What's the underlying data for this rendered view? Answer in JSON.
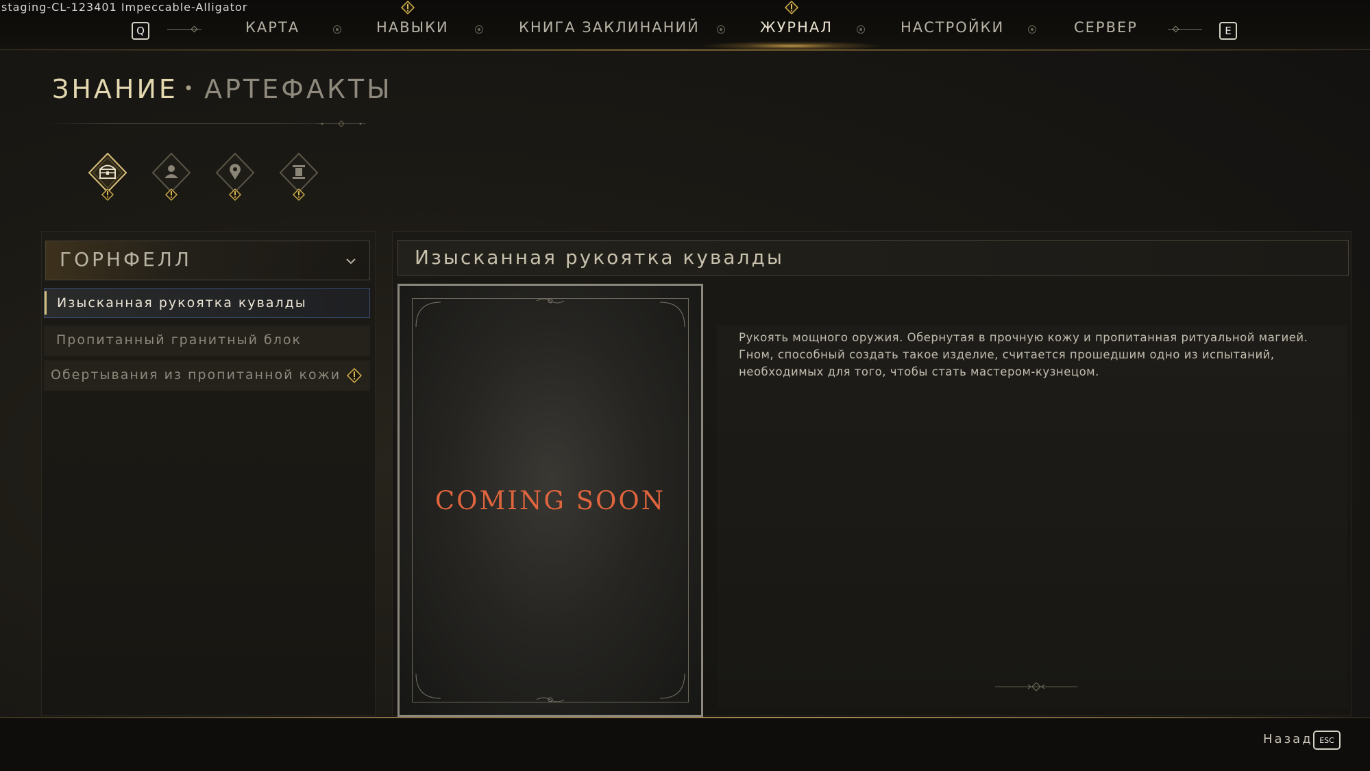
{
  "build_label": "staging-CL-123401 Impeccable-Alligator",
  "nav": {
    "left_key": "Q",
    "right_key": "E",
    "tabs": [
      {
        "label": "КАРТА",
        "active": false,
        "alert": false
      },
      {
        "label": "НАВЫКИ",
        "active": false,
        "alert": true
      },
      {
        "label": "КНИГА ЗАКЛИНАНИЙ",
        "active": false,
        "alert": false
      },
      {
        "label": "ЖУРНАЛ",
        "active": true,
        "alert": true
      },
      {
        "label": "НАСТРОЙКИ",
        "active": false,
        "alert": false
      },
      {
        "label": "СЕРВЕР",
        "active": false,
        "alert": false
      }
    ]
  },
  "header": {
    "section": "ЗНАНИЕ",
    "separator": "•",
    "subsection": "АРТЕФАКТЫ"
  },
  "categories": [
    {
      "icon": "chest-icon",
      "active": true,
      "alert": true
    },
    {
      "icon": "person-icon",
      "active": false,
      "alert": true
    },
    {
      "icon": "location-pin-icon",
      "active": false,
      "alert": true
    },
    {
      "icon": "pillar-icon",
      "active": false,
      "alert": true
    }
  ],
  "left": {
    "region": "ГОРНФЕЛЛ",
    "items": [
      {
        "label": "Изысканная рукоятка кувалды",
        "selected": true,
        "alert": false
      },
      {
        "label": "Пропитанный гранитный блок",
        "selected": false,
        "alert": false
      },
      {
        "label": "Обертывания из пропитанной кожи",
        "selected": false,
        "alert": true
      }
    ]
  },
  "detail": {
    "title": "Изысканная рукоятка кувалды",
    "image_text": "COMING SOON",
    "description": "Рукоять мощного оружия. Обернутая в прочную кожу и пропитанная ритуальной магией. Гном, способный создать такое изделие, считается прошедшим одно из испытаний, необходимых для того, чтобы стать мастером-кузнецом."
  },
  "footer": {
    "back_label": "Назад",
    "back_key": "ESC"
  },
  "colors": {
    "accent_gold": "#d8c07a",
    "alert_gold": "#c9a84a",
    "coming_soon": "#e0653e",
    "selection_border": "#3a4a72"
  }
}
